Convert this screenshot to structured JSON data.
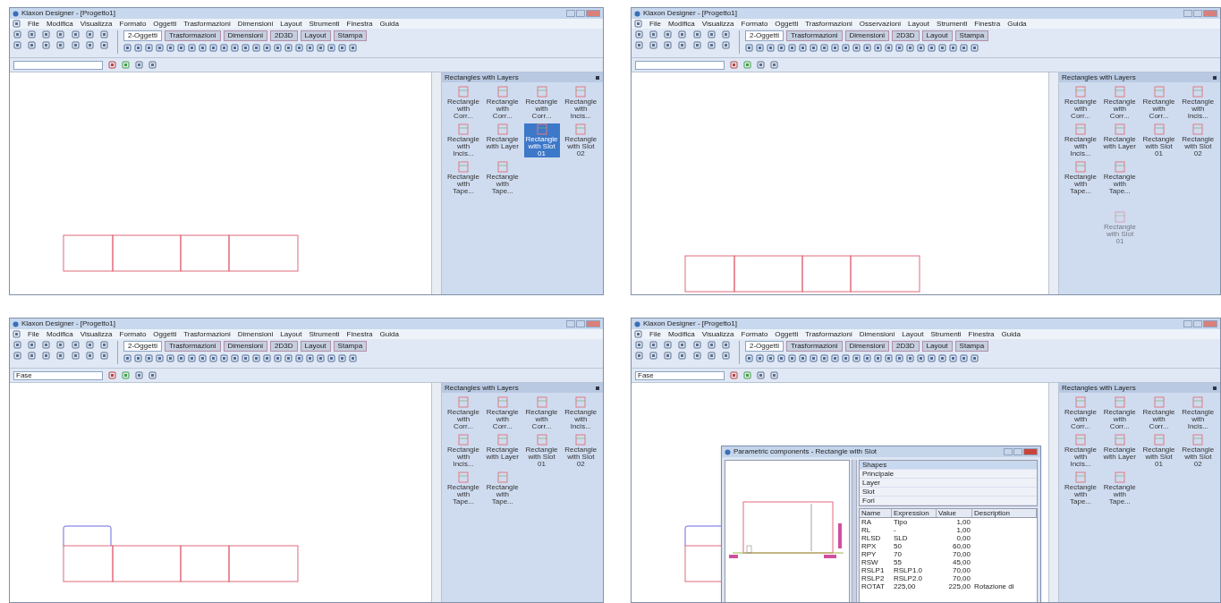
{
  "screens": [
    {
      "title": "Klaxon Designer - [Progetto1]",
      "menu": [
        "File",
        "Modifica",
        "Visualizza",
        "Formato",
        "Oggetti",
        "Trasformazioni",
        "Dimensioni",
        "Layout",
        "Strumenti",
        "Finestra",
        "Guida"
      ],
      "tabs": [
        {
          "label": "2-Oggetti",
          "selected": true
        },
        {
          "label": "Trasformazioni",
          "selected": false
        },
        {
          "label": "Dimensioni",
          "selected": false
        },
        {
          "label": "2D3D",
          "selected": false
        },
        {
          "label": "Layout",
          "selected": false
        },
        {
          "label": "Stampa",
          "selected": false
        }
      ],
      "drawing": {
        "kind": "strip"
      },
      "palette": {
        "title": "Rectangles with Layers",
        "items": [
          {
            "label": "Rectangle with Corr...",
            "selected": false
          },
          {
            "label": "Rectangle with Corr...",
            "selected": false
          },
          {
            "label": "Rectangle with Corr...",
            "selected": false
          },
          {
            "label": "Rectangle with Incis...",
            "selected": false
          },
          {
            "label": "Rectangle with Incis...",
            "selected": false
          },
          {
            "label": "Rectangle with Layer",
            "selected": false
          },
          {
            "label": "Rectangle with Slot 01",
            "selected": true
          },
          {
            "label": "Rectangle with Slot 02",
            "selected": false
          },
          {
            "label": "Rectangle with Tape...",
            "selected": false
          },
          {
            "label": "Rectangle with Tape...",
            "selected": false
          }
        ]
      }
    },
    {
      "title": "Klaxon Designer - [Progetto1]",
      "menu": [
        "File",
        "Modifica",
        "Visualizza",
        "Formato",
        "Oggetti",
        "Trasformazioni",
        "Osservazioni",
        "Layout",
        "Strumenti",
        "Finestra",
        "Guida"
      ],
      "tabs": [
        {
          "label": "2-Oggetti",
          "selected": true
        },
        {
          "label": "Trasformazioni",
          "selected": false
        },
        {
          "label": "Dimensioni",
          "selected": false
        },
        {
          "label": "2D3D",
          "selected": false
        },
        {
          "label": "Layout",
          "selected": false
        },
        {
          "label": "Stampa",
          "selected": false
        }
      ],
      "drawing": {
        "kind": "strip-low"
      },
      "palette": {
        "title": "Rectangles with Layers",
        "items": [
          {
            "label": "Rectangle with Corr...",
            "selected": false
          },
          {
            "label": "Rectangle with Corr...",
            "selected": false
          },
          {
            "label": "Rectangle with Corr...",
            "selected": false
          },
          {
            "label": "Rectangle with Incis...",
            "selected": false
          },
          {
            "label": "Rectangle with Incis...",
            "selected": false
          },
          {
            "label": "Rectangle with Layer",
            "selected": false
          },
          {
            "label": "Rectangle with Slot 01",
            "selected": false
          },
          {
            "label": "Rectangle with Slot 02",
            "selected": false
          },
          {
            "label": "Rectangle with Tape...",
            "selected": false
          },
          {
            "label": "Rectangle with Tape...",
            "selected": false
          }
        ],
        "dragged": {
          "label": "Rectangle with Slot 01"
        }
      }
    },
    {
      "title": "Klaxon Designer - [Progetto1]",
      "menu": [
        "File",
        "Modifica",
        "Visualizza",
        "Formato",
        "Oggetti",
        "Trasformazioni",
        "Dimensioni",
        "Layout",
        "Strumenti",
        "Finestra",
        "Guida"
      ],
      "tabs": [
        {
          "label": "2-Oggetti",
          "selected": true
        },
        {
          "label": "Trasformazioni",
          "selected": false
        },
        {
          "label": "Dimensioni",
          "selected": false
        },
        {
          "label": "2D3D",
          "selected": false
        },
        {
          "label": "Layout",
          "selected": false
        },
        {
          "label": "Stampa",
          "selected": false
        }
      ],
      "combo": {
        "value": "Fase"
      },
      "drawing": {
        "kind": "strip-lid"
      },
      "palette": {
        "title": "Rectangles with Layers",
        "items": [
          {
            "label": "Rectangle with Corr...",
            "selected": false
          },
          {
            "label": "Rectangle with Corr...",
            "selected": false
          },
          {
            "label": "Rectangle with Corr...",
            "selected": false
          },
          {
            "label": "Rectangle with Incis...",
            "selected": false
          },
          {
            "label": "Rectangle with Incis...",
            "selected": false
          },
          {
            "label": "Rectangle with Layer",
            "selected": false
          },
          {
            "label": "Rectangle with Slot 01",
            "selected": false
          },
          {
            "label": "Rectangle with Slot 02",
            "selected": false
          },
          {
            "label": "Rectangle with Tape...",
            "selected": false
          },
          {
            "label": "Rectangle with Tape...",
            "selected": false
          }
        ]
      }
    },
    {
      "title": "Klaxon Designer - [Progetto1]",
      "menu": [
        "File",
        "Modifica",
        "Visualizza",
        "Formato",
        "Oggetti",
        "Trasformazioni",
        "Dimensioni",
        "Layout",
        "Strumenti",
        "Finestra",
        "Guida"
      ],
      "tabs": [
        {
          "label": "2-Oggetti",
          "selected": true
        },
        {
          "label": "Trasformazioni",
          "selected": false
        },
        {
          "label": "Dimensioni",
          "selected": false
        },
        {
          "label": "2D3D",
          "selected": false
        },
        {
          "label": "Layout",
          "selected": false
        },
        {
          "label": "Stampa",
          "selected": false
        }
      ],
      "combo": {
        "value": "Fase"
      },
      "drawing": {
        "kind": "strip-lid"
      },
      "palette": {
        "title": "Rectangles with Layers",
        "items": [
          {
            "label": "Rectangle with Corr...",
            "selected": false
          },
          {
            "label": "Rectangle with Corr...",
            "selected": false
          },
          {
            "label": "Rectangle with Corr...",
            "selected": false
          },
          {
            "label": "Rectangle with Incis...",
            "selected": false
          },
          {
            "label": "Rectangle with Incis...",
            "selected": false
          },
          {
            "label": "Rectangle with Layer",
            "selected": false
          },
          {
            "label": "Rectangle with Slot 01",
            "selected": false
          },
          {
            "label": "Rectangle with Slot 02",
            "selected": false
          },
          {
            "label": "Rectangle with Tape...",
            "selected": false
          },
          {
            "label": "Rectangle with Tape...",
            "selected": false
          }
        ]
      },
      "dialog": {
        "title": "Parametric components - Rectangle with Slot",
        "shapes": [
          {
            "label": "Shapes",
            "selected": true
          },
          {
            "label": "Principale",
            "selected": false
          },
          {
            "label": "Layer",
            "selected": false
          },
          {
            "label": "Slot",
            "selected": false
          },
          {
            "label": "Fori",
            "selected": false
          }
        ],
        "columns": [
          "Name",
          "Expression",
          "Value",
          "Description"
        ],
        "rows": [
          [
            "RA",
            "Tipo",
            "1,00",
            ""
          ],
          [
            "RL",
            "-",
            "1,00",
            ""
          ],
          [
            "RLSD",
            "SLD",
            "0,00",
            ""
          ],
          [
            "RPX",
            "50",
            "60,00",
            ""
          ],
          [
            "RPY",
            "70",
            "70,00",
            ""
          ],
          [
            "RSW",
            "55",
            "45,00",
            ""
          ],
          [
            "RSLP1",
            "RSLP1.0",
            "70,00",
            ""
          ],
          [
            "RSLP2",
            "RSLP2.0",
            "70,00",
            ""
          ],
          [
            "ROTAT",
            "225,00",
            "225,00",
            "Rotazione di"
          ]
        ]
      }
    }
  ]
}
